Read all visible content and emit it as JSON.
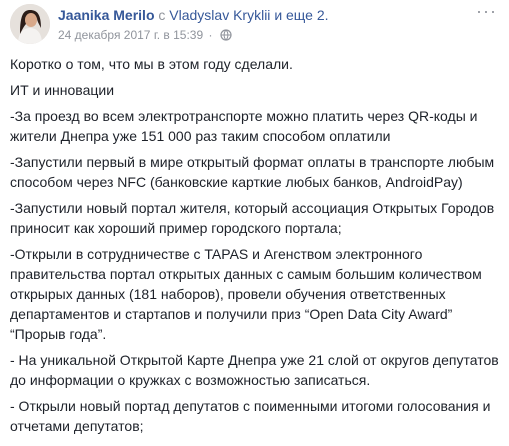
{
  "post": {
    "author": "Jaanika Merilo",
    "with_prefix": "с",
    "tagged": "Vladyslav Kryklii",
    "and_more": "и еще 2.",
    "timestamp": "24 декабря 2017 г. в 15:39",
    "separator": "·",
    "more_menu": "···",
    "paragraphs": [
      "Коротко о том, что мы в этом году сделали.",
      "ИТ и инновации",
      "-За проезд во всем электротранспорте можно платить через QR-коды и жители Днепра уже 151 000 раз таким способом оплатили",
      "-Запустили первый в мире открытый формат оплаты в транспорте любым способом через NFC (банковские карткие любых банков, AndroidPay)",
      "-Запустили новый портал жителя, который ассоциация Открытых Городов приносит как хороший пример городского портала;",
      "-Открыли в сотрудничестве с TAPAS и Агенством электронного правительства портал открытых данных с самым большим количеством открырых данных (181 наборов), провели обучения ответственных департаментов и стартапов и получили приз “Open Data City Award” “Прорыв года”.",
      "- На уникальной Открытой Карте Днепра уже 21 слой от округов депутатов до информации о кружках с возможностью записаться.",
      "- Открыли новый портад депутатов с поименными итогоми голосования и отчетами депутатов;"
    ]
  },
  "icons": {
    "avatar": "profile-photo",
    "privacy": "globe-icon",
    "menu": "more-options-icon"
  }
}
